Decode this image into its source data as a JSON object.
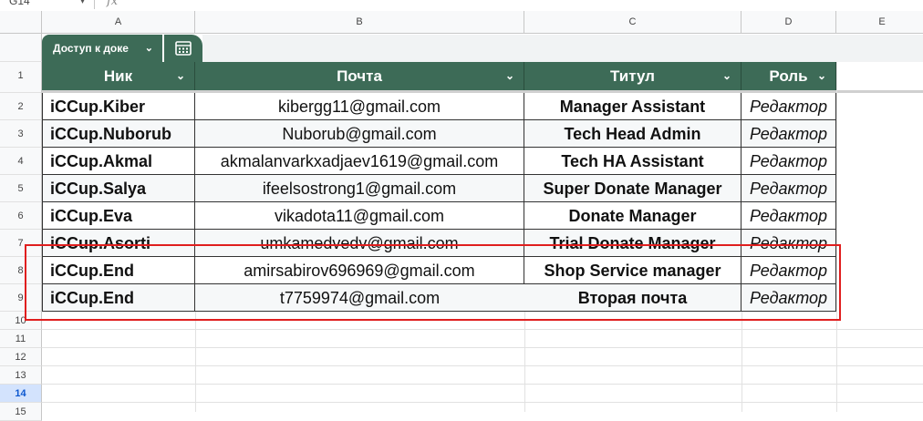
{
  "formula_bar": {
    "cell_ref": "G14",
    "fx": "fx"
  },
  "columns": [
    "A",
    "B",
    "C",
    "D",
    "E"
  ],
  "rows": [
    "1",
    "2",
    "3",
    "4",
    "5",
    "6",
    "7",
    "8",
    "9",
    "10",
    "11",
    "12",
    "13",
    "14",
    "15"
  ],
  "selected_row": "14",
  "table_chip": {
    "label": "Доступ к доке"
  },
  "table": {
    "headers": [
      "Ник",
      "Почта",
      "Титул",
      "Роль"
    ],
    "rows": [
      [
        "iCCup.Kiber",
        "kibergg11@gmail.com",
        "Manager Assistant",
        "Редактор"
      ],
      [
        "iCCup.Nuborub",
        "Nuborub@gmail.com",
        "Tech Head Admin",
        "Редактор"
      ],
      [
        "iCCup.Akmal",
        "akmalanvarkxadjaev1619@gmail.com",
        "Tech HA Assistant",
        "Редактор"
      ],
      [
        "iCCup.Salya",
        "ifeelsostrong1@gmail.com",
        "Super Donate Manager",
        "Редактор"
      ],
      [
        "iCCup.Eva",
        "vikadota11@gmail.com",
        "Donate Manager",
        "Редактор"
      ],
      [
        "iCCup.Asorti",
        "umkamedvedv@gmail.com",
        "Trial Donate Manager",
        "Редактор"
      ],
      [
        "iCCup.End",
        "amirsabirov696969@gmail.com",
        "Shop Service manager",
        "Редактор"
      ],
      [
        "iCCup.End",
        "t7759974@gmail.com",
        "Вторая почта",
        "Редактор"
      ]
    ]
  },
  "colors": {
    "header_bg": "#3d6b57",
    "highlight": "#e01e1e",
    "selected_row": "#d3e3fd"
  }
}
